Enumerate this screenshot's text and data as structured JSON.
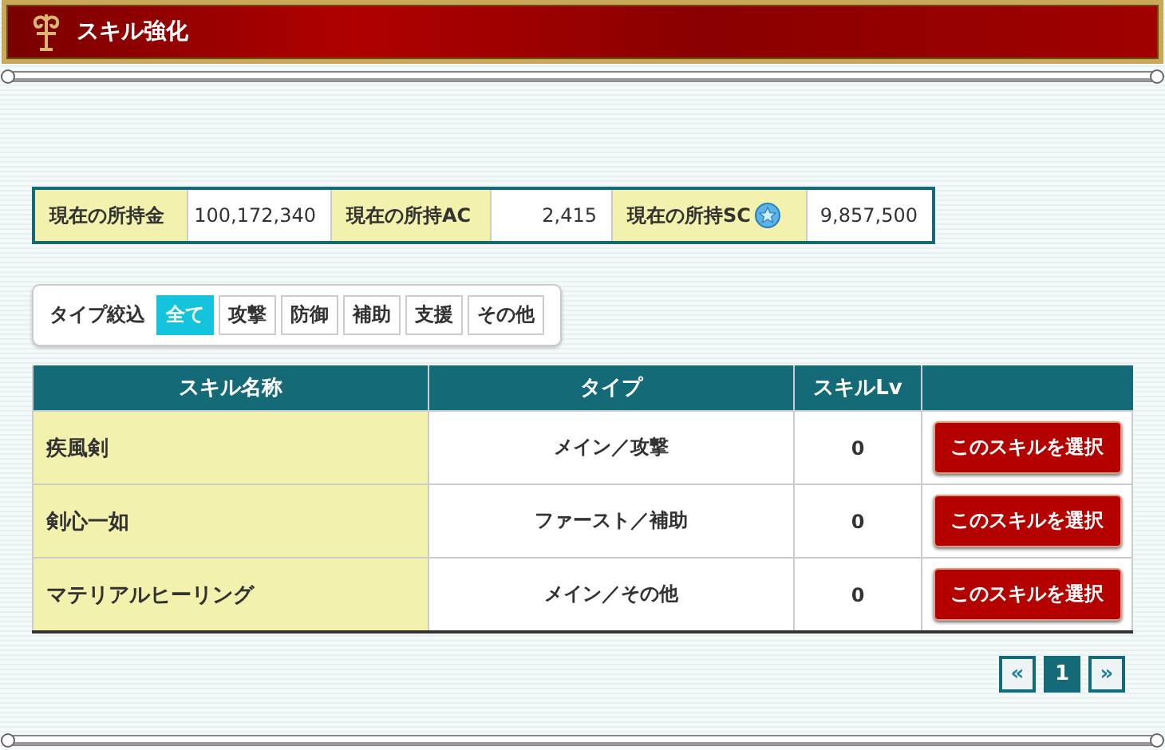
{
  "window": {
    "title": "スキル強化"
  },
  "currency": [
    {
      "label": "現在の所持金",
      "value": "100,172,340",
      "kind": "plain"
    },
    {
      "label": "現在の所持AC",
      "value": "2,415",
      "kind": "plain"
    },
    {
      "label": "現在の所持SC",
      "value": "9,857,500",
      "kind": "gem"
    }
  ],
  "filter": {
    "label": "タイプ絞込",
    "options": [
      {
        "label": "全て",
        "selected": true
      },
      {
        "label": "攻撃",
        "selected": false
      },
      {
        "label": "防御",
        "selected": false
      },
      {
        "label": "補助",
        "selected": false
      },
      {
        "label": "支援",
        "selected": false
      },
      {
        "label": "その他",
        "selected": false
      }
    ]
  },
  "table": {
    "columns": [
      "スキル名称",
      "タイプ",
      "スキルLv"
    ],
    "rows": [
      {
        "name": "疾風剣",
        "type": "メイン／攻撃",
        "level": "0",
        "action": "このスキルを選択"
      },
      {
        "name": "剣心一如",
        "type": "ファースト／補助",
        "level": "0",
        "action": "このスキルを選択"
      },
      {
        "name": "マテリアルヒーリング",
        "type": "メイン／その他",
        "level": "0",
        "action": "このスキルを選択"
      }
    ]
  },
  "pagination": {
    "prev": "«",
    "pages": [
      {
        "label": "1",
        "selected": true
      }
    ],
    "next": "»"
  }
}
